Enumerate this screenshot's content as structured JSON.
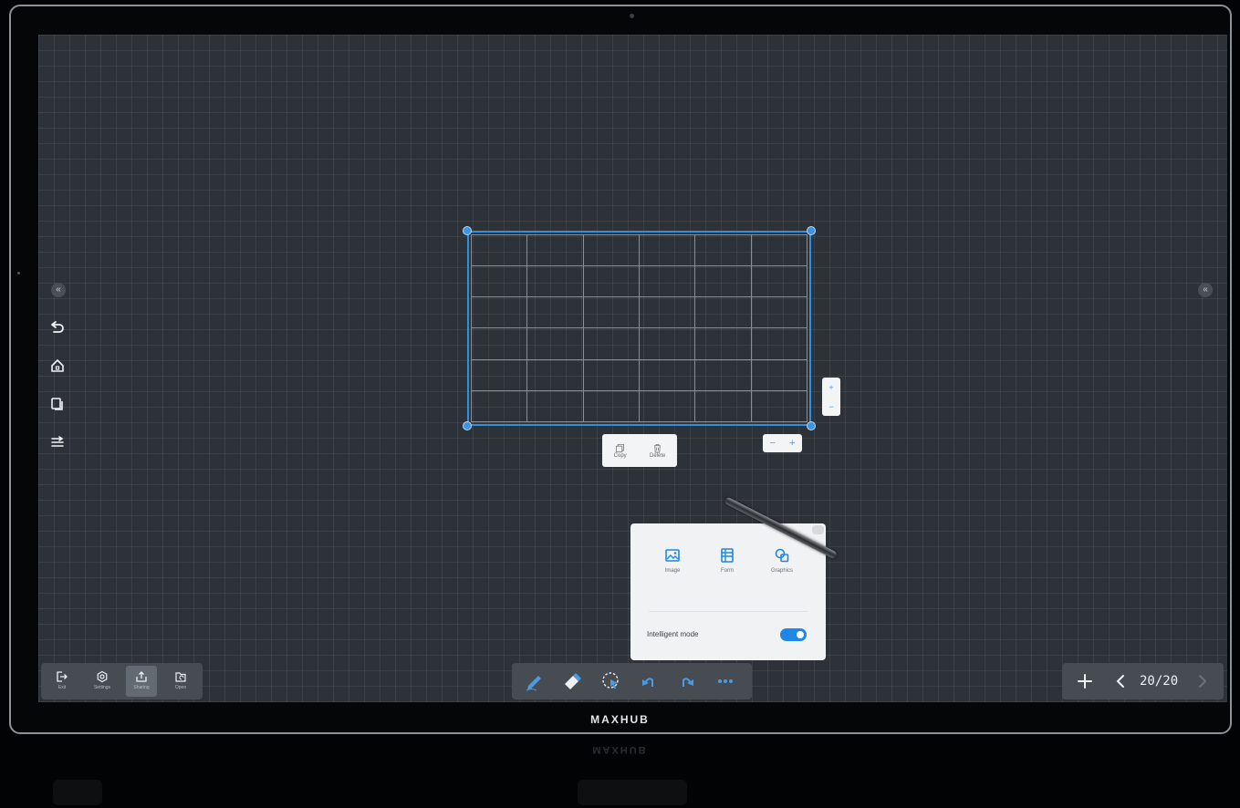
{
  "device": {
    "brand": "MAXHUB"
  },
  "left_panel": {
    "collapse_label": "«"
  },
  "right_panel": {
    "collapse_label": "«"
  },
  "table_object": {
    "rows": 6,
    "columns": 6
  },
  "context_menu": {
    "copy_label": "Copy",
    "delete_label": "Delete"
  },
  "resize_controls": {
    "minus": "−",
    "plus": "+"
  },
  "insert_popup": {
    "items": [
      {
        "label": "Image",
        "icon": "image-icon"
      },
      {
        "label": "Form",
        "icon": "form-icon"
      },
      {
        "label": "Graphics",
        "icon": "graphics-icon"
      }
    ],
    "intelligent_mode_label": "Intelligent mode",
    "intelligent_mode_on": true
  },
  "bottom_left_toolbar": {
    "items": [
      {
        "label": "Exit",
        "icon": "exit-icon"
      },
      {
        "label": "Settings",
        "icon": "settings-icon"
      },
      {
        "label": "Sharing",
        "icon": "share-icon"
      },
      {
        "label": "Open",
        "icon": "open-folder-icon"
      }
    ],
    "active_index": 2
  },
  "bottom_center_toolbar": {
    "tools": [
      "pen-icon",
      "eraser-icon",
      "select-icon",
      "undo-icon",
      "redo-icon",
      "more-icon"
    ]
  },
  "page_nav": {
    "current": 20,
    "total": 20,
    "page_label": "20/20"
  },
  "colors": {
    "accent": "#1f86e8",
    "canvas": "#2d3138",
    "toolbar": "#474c53",
    "selection": "#2f8fe0"
  }
}
